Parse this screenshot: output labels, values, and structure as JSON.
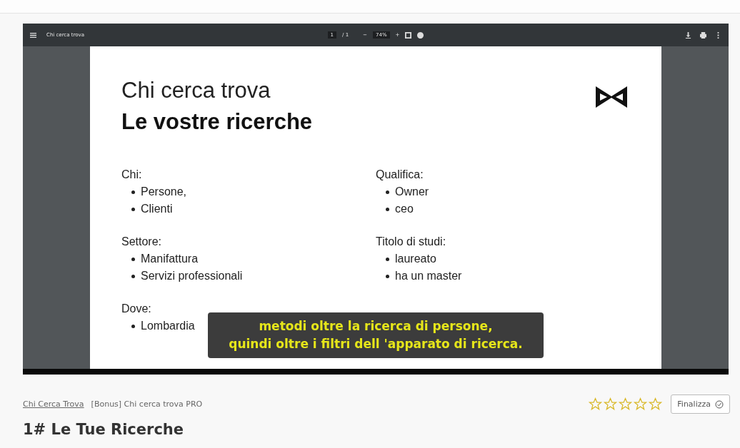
{
  "viewer": {
    "title": "Chi cerca trova",
    "page": "1",
    "page_total": "/ 1",
    "zoom_out": "−",
    "zoom": "74%",
    "zoom_in": "+"
  },
  "document": {
    "heading": "Chi cerca trova",
    "subheading": "Le vostre ricerche",
    "columns": [
      [
        {
          "label": "Chi:",
          "items": [
            "Persone,",
            "Clienti"
          ]
        },
        {
          "label": "Settore:",
          "items": [
            "Manifattura",
            "Servizi professionali"
          ]
        },
        {
          "label": "Dove:",
          "items": [
            "Lombardia"
          ]
        }
      ],
      [
        {
          "label": "Qualifica:",
          "items": [
            "Owner",
            "ceo"
          ]
        },
        {
          "label": "Titolo di studi:",
          "items": [
            "laureato",
            "ha un master"
          ]
        }
      ]
    ]
  },
  "subtitle": [
    "metodi oltre la ricerca di persone,",
    "quindi oltre i filtri dell 'apparato di ricerca."
  ],
  "breadcrumb": [
    {
      "label": "Chi Cerca Trova",
      "kind": "link"
    },
    {
      "label": "[Bonus] Chi cerca trova PRO",
      "kind": "text"
    }
  ],
  "rating": {
    "stars": 0
  },
  "finish_button": "Finalizza",
  "lesson_title": "1# Le Tue Ricerche"
}
